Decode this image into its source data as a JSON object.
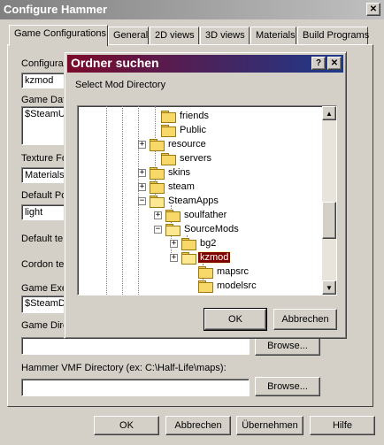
{
  "main": {
    "title": "Configure Hammer",
    "close_glyph": "✕",
    "tabs": [
      {
        "label": "Game Configurations",
        "active": true
      },
      {
        "label": "General"
      },
      {
        "label": "2D views"
      },
      {
        "label": "3D views"
      },
      {
        "label": "Materials"
      },
      {
        "label": "Build Programs"
      }
    ],
    "fields": {
      "configurations_label": "Configurat",
      "configurations_value": "kzmod",
      "game_data_label": "Game Dat",
      "game_data_value": "$SteamU",
      "texture_format_label": "Texture Fo",
      "texture_format_value": "Materials",
      "default_point_label": "Default Po",
      "default_point_value": "light",
      "default_texture_label": "Default te",
      "cordon_texture_label": "Cordon te",
      "game_exe_label": "Game Exe",
      "game_exe_value": "$SteamD",
      "game_dir_label": "Game Dire",
      "game_dir_value": "",
      "hammer_vmf_label": "Hammer VMF Directory (ex: C:\\Half-Life\\maps):",
      "hammer_vmf_value": ""
    },
    "browse_label": "Browse...",
    "buttons": {
      "ok": "OK",
      "cancel": "Abbrechen",
      "apply": "Übernehmen",
      "help": "Hilfe"
    }
  },
  "dialog": {
    "title": "Ordner suchen",
    "help_glyph": "?",
    "close_glyph": "✕",
    "prompt": "Select Mod Directory",
    "tree": [
      {
        "label": "friends",
        "expander": ""
      },
      {
        "label": "Public",
        "expander": ""
      },
      {
        "label": "resource",
        "expander": "+"
      },
      {
        "label": "servers",
        "expander": ""
      },
      {
        "label": "skins",
        "expander": "+"
      },
      {
        "label": "steam",
        "expander": "+"
      },
      {
        "label": "SteamApps",
        "expander": "−",
        "open": true
      },
      {
        "label": "soulfather",
        "expander": "+"
      },
      {
        "label": "SourceMods",
        "expander": "−",
        "open": true
      },
      {
        "label": "bg2",
        "expander": "+"
      },
      {
        "label": "kzmod",
        "expander": "+",
        "selected": true,
        "open": true
      },
      {
        "label": "mapsrc",
        "expander": ""
      },
      {
        "label": "modelsrc",
        "expander": ""
      }
    ],
    "scroll_up_glyph": "▲",
    "scroll_down_glyph": "▼",
    "ok_label": "OK",
    "cancel_label": "Abbrechen"
  },
  "colors": {
    "face": "#d4d0c8",
    "dialog_title_start": "#7b0a2a",
    "dialog_title_end": "#1c3a8c",
    "selection": "#800000",
    "folder": "#f8d868"
  }
}
